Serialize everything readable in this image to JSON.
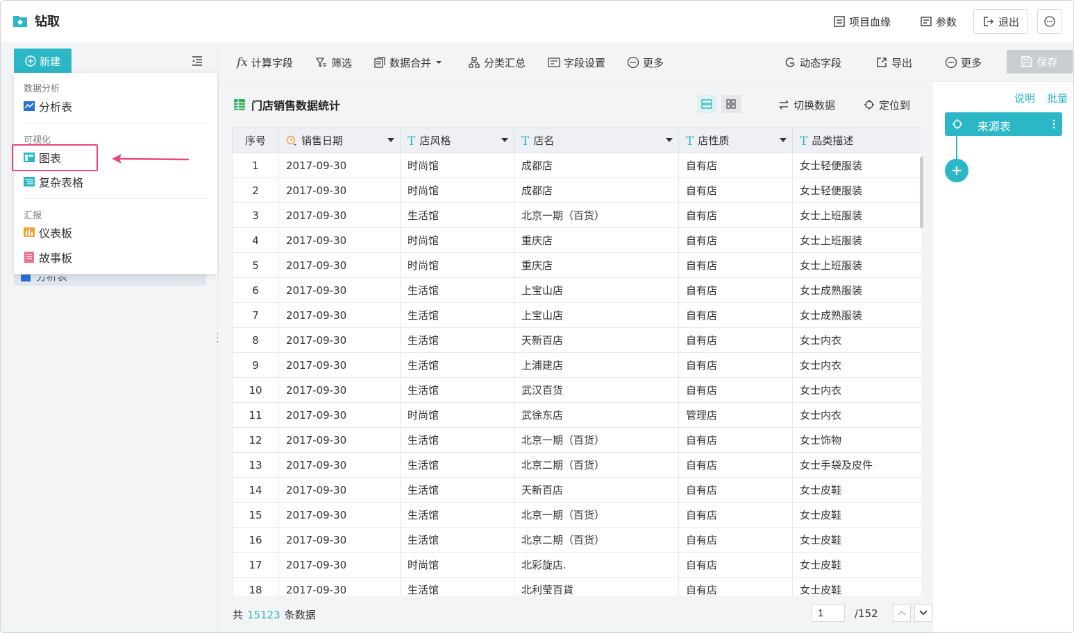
{
  "header": {
    "app_title": "钻取",
    "lineage_label": "项目血缘",
    "params_label": "参数",
    "exit_label": "退出"
  },
  "left": {
    "new_label": "新建",
    "background_item": "分析表"
  },
  "dropdown": {
    "section_analysis": "数据分析",
    "item_analysis_table": "分析表",
    "section_visual": "可视化",
    "item_chart": "图表",
    "item_complex_table": "复杂表格",
    "section_report": "汇报",
    "item_dashboard": "仪表板",
    "item_storyboard": "故事板"
  },
  "toolbar": {
    "calc_field": "计算字段",
    "filter": "筛选",
    "data_merge": "数据合并",
    "group_summary": "分类汇总",
    "field_settings": "字段设置",
    "more1": "更多",
    "dynamic_field": "动态字段",
    "export": "导出",
    "more2": "更多",
    "save": "保存"
  },
  "table": {
    "title": "门店销售数据统计",
    "switch_data": "切换数据",
    "locate": "定位到",
    "columns": [
      "序号",
      "销售日期",
      "店风格",
      "店名",
      "店性质",
      "品类描述"
    ],
    "rows": [
      [
        "1",
        "2017-09-30",
        "时尚馆",
        "成都店",
        "自有店",
        "女士轻便服装"
      ],
      [
        "2",
        "2017-09-30",
        "时尚馆",
        "成都店",
        "自有店",
        "女士轻便服装"
      ],
      [
        "3",
        "2017-09-30",
        "生活馆",
        "北京一期（百货）",
        "自有店",
        "女士上班服装"
      ],
      [
        "4",
        "2017-09-30",
        "时尚馆",
        "重庆店",
        "自有店",
        "女士上班服装"
      ],
      [
        "5",
        "2017-09-30",
        "时尚馆",
        "重庆店",
        "自有店",
        "女士上班服装"
      ],
      [
        "6",
        "2017-09-30",
        "生活馆",
        "上宝山店",
        "自有店",
        "女士成熟服装"
      ],
      [
        "7",
        "2017-09-30",
        "生活馆",
        "上宝山店",
        "自有店",
        "女士成熟服装"
      ],
      [
        "8",
        "2017-09-30",
        "生活馆",
        "天新百店",
        "自有店",
        "女士内衣"
      ],
      [
        "9",
        "2017-09-30",
        "生活馆",
        "上浦建店",
        "自有店",
        "女士内衣"
      ],
      [
        "10",
        "2017-09-30",
        "生活馆",
        "武汉百货",
        "自有店",
        "女士内衣"
      ],
      [
        "11",
        "2017-09-30",
        "时尚馆",
        "武徐东店",
        "管理店",
        "女士内衣"
      ],
      [
        "12",
        "2017-09-30",
        "生活馆",
        "北京一期（百货）",
        "自有店",
        "女士饰物"
      ],
      [
        "13",
        "2017-09-30",
        "生活馆",
        "北京二期（百货）",
        "自有店",
        "女士手袋及皮件"
      ],
      [
        "14",
        "2017-09-30",
        "生活馆",
        "天新百店",
        "自有店",
        "女士皮鞋"
      ],
      [
        "15",
        "2017-09-30",
        "生活馆",
        "北京一期（百货）",
        "自有店",
        "女士皮鞋"
      ],
      [
        "16",
        "2017-09-30",
        "生活馆",
        "北京二期（百货）",
        "自有店",
        "女士皮鞋"
      ],
      [
        "17",
        "2017-09-30",
        "时尚馆",
        "北彩旋店.",
        "自有店",
        "女士皮鞋"
      ],
      [
        "18",
        "2017-09-30",
        "生活馆",
        "北利莹百貨",
        "自有店",
        "女士皮鞋"
      ]
    ]
  },
  "footer": {
    "total_prefix": "共",
    "total_count": "15123",
    "total_suffix": "条数据",
    "page_value": "1",
    "page_total": "/152"
  },
  "right": {
    "explain": "说明",
    "batch": "批量",
    "source_node": "来源表"
  },
  "colors": {
    "accent": "#2bb7c6",
    "highlight": "#e8477b"
  }
}
